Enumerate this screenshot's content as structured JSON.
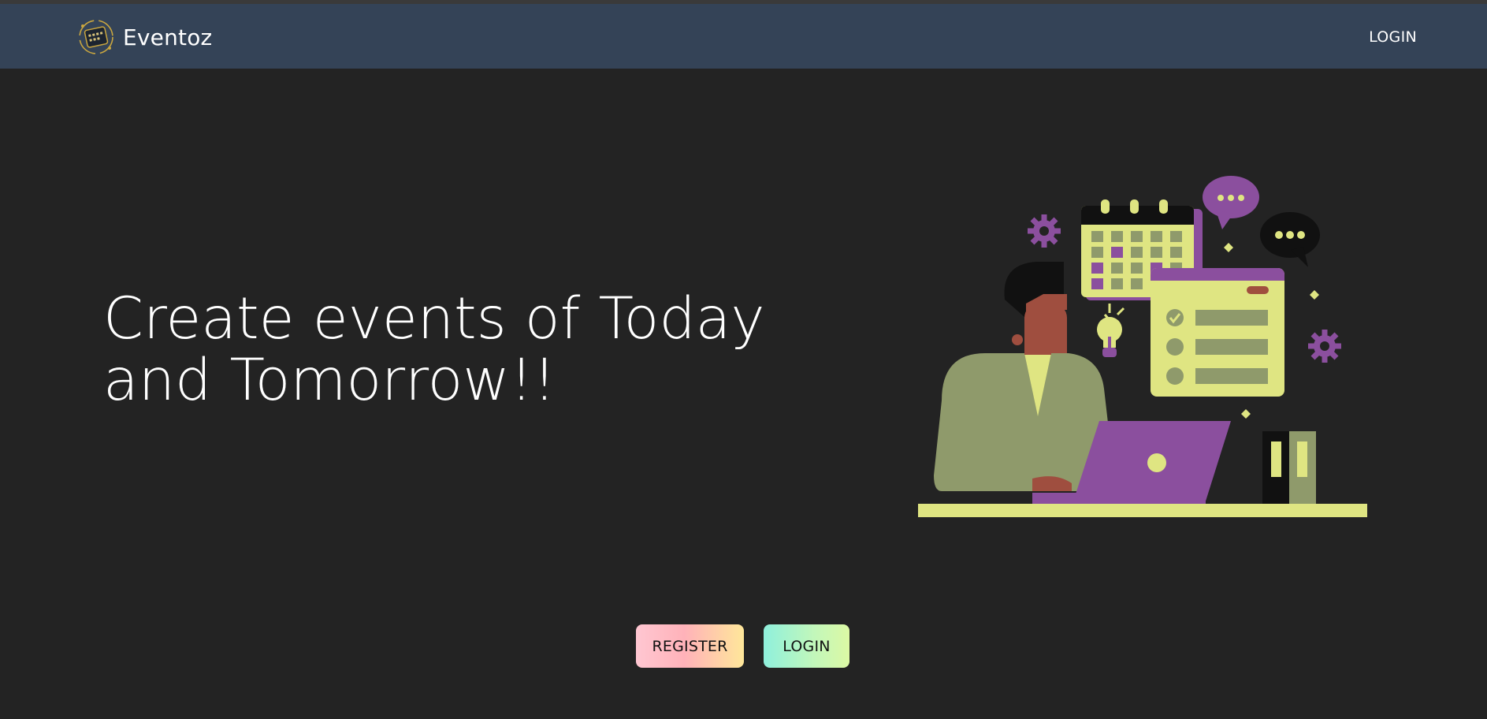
{
  "navbar": {
    "brand_name": "Eventoz",
    "login_link": "LOGIN",
    "background_color": "#344357"
  },
  "hero": {
    "title": "Create events of Today and Tomorrow!!",
    "illustration": "person-at-laptop-with-calendar-illustration"
  },
  "actions": {
    "register_label": "REGISTER",
    "login_label": "LOGIN"
  },
  "colors": {
    "page_background": "#232323",
    "illustration_purple": "#8b4f9e",
    "illustration_lime": "#dfe582",
    "illustration_olive": "#8f9a6b"
  }
}
